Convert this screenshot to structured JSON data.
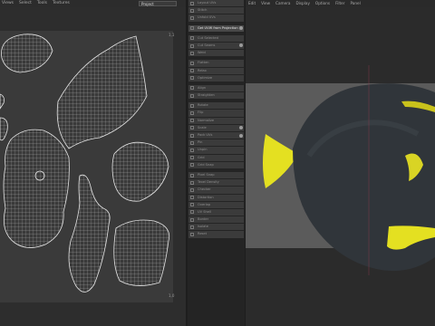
{
  "uv_editor": {
    "menu": [
      "Views",
      "Select",
      "Tools",
      "Textures"
    ],
    "project_dropdown": "Project",
    "corner_labels": {
      "top_right": "1,1",
      "bottom_right": "1,0"
    }
  },
  "tools_panel": {
    "items": [
      {
        "label": "Layout UVs",
        "highlight": false
      },
      {
        "label": "Stitch",
        "highlight": false
      },
      {
        "label": "Unfold UVs",
        "highlight": false
      },
      {
        "label": "Get UVW from Projection",
        "highlight": true,
        "info": true
      },
      {
        "label": "Cut Selected",
        "highlight": false
      },
      {
        "label": "Cut Seams",
        "highlight": false,
        "info": true
      },
      {
        "label": "Weld",
        "highlight": false
      },
      {
        "label": "Flatten",
        "highlight": false
      },
      {
        "label": "Relax",
        "highlight": false
      },
      {
        "label": "Optimize",
        "highlight": false
      },
      {
        "label": "Align",
        "highlight": false
      },
      {
        "label": "Straighten",
        "highlight": false
      },
      {
        "label": "Rotate",
        "highlight": false
      },
      {
        "label": "Flip",
        "highlight": false
      },
      {
        "label": "Normalize",
        "highlight": false
      },
      {
        "label": "Scale",
        "highlight": false
      },
      {
        "label": "Pack UVs",
        "highlight": false
      },
      {
        "label": "Pin",
        "highlight": false
      },
      {
        "label": "Unpin",
        "highlight": false
      },
      {
        "label": "Grid",
        "highlight": false
      },
      {
        "label": "Grid Snap",
        "highlight": false
      },
      {
        "label": "Pixel Snap",
        "highlight": false
      },
      {
        "label": "Texel Density",
        "highlight": false
      },
      {
        "label": "Checker",
        "highlight": false
      },
      {
        "label": "Distortion",
        "highlight": false
      },
      {
        "label": "Overlap",
        "highlight": false
      },
      {
        "label": "UV Shell",
        "highlight": false
      },
      {
        "label": "Border",
        "highlight": false
      },
      {
        "label": "Isolate",
        "highlight": false
      },
      {
        "label": "Reset",
        "highlight": false
      }
    ]
  },
  "viewport": {
    "menu": [
      "Edit",
      "View",
      "Camera",
      "Display",
      "Options",
      "Filter",
      "Panel"
    ]
  },
  "colors": {
    "fish_body": "#2f3337",
    "fish_fin": "#e6e22a",
    "uv_wire": "#d8d8d8"
  }
}
